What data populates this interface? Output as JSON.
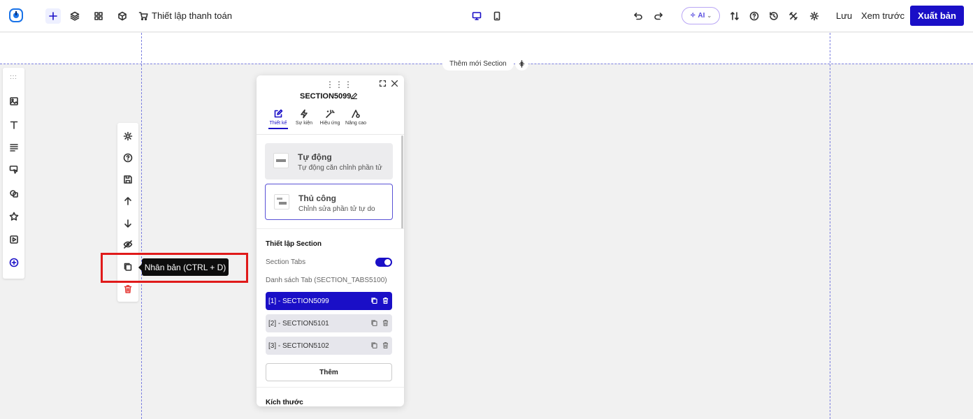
{
  "topbar": {
    "title": "Thiết lập thanh toán",
    "ai_label": "AI",
    "save_label": "Lưu",
    "preview_label": "Xem trước",
    "publish_label": "Xuất bản",
    "accent_color": "#1a0fc7"
  },
  "canvas": {
    "add_section_label": "Thêm mới Section"
  },
  "left_toolbar": {
    "items": [
      "drag-grip",
      "image",
      "text",
      "paragraph",
      "cursor",
      "shapes",
      "star",
      "video",
      "add-circle"
    ]
  },
  "element_toolbar": {
    "items": [
      "settings",
      "help",
      "save",
      "move-up",
      "move-down",
      "hide",
      "duplicate",
      "delete"
    ],
    "tooltip": "Nhân bản (CTRL + D)",
    "highlight_color": "#e01a1a"
  },
  "panel": {
    "title": "SECTION5099",
    "tabs": [
      {
        "label": "Thiết kế",
        "icon": "edit-icon"
      },
      {
        "label": "Sự kiện",
        "icon": "lightning-icon"
      },
      {
        "label": "Hiệu ứng",
        "icon": "magic-wand-icon"
      },
      {
        "label": "Nâng cao",
        "icon": "advanced-icon"
      }
    ],
    "active_tab": "Thiết kế",
    "modes": {
      "auto": {
        "title": "Tự động",
        "subtitle": "Tự động căn chỉnh phần tử"
      },
      "manual": {
        "title": "Thủ công",
        "subtitle": "Chỉnh sửa phần tử tự do"
      }
    },
    "section_settings_title": "Thiết lập Section",
    "section_tabs_label": "Section Tabs",
    "section_tabs_enabled": true,
    "tab_list_label": "Danh sách Tab (SECTION_TABS5100)",
    "tab_list": [
      {
        "label": "[1] - SECTION5099",
        "active": true
      },
      {
        "label": "[2] - SECTION5101",
        "active": false
      },
      {
        "label": "[3] - SECTION5102",
        "active": false
      }
    ],
    "add_label": "Thêm",
    "size_title": "Kích thước"
  }
}
